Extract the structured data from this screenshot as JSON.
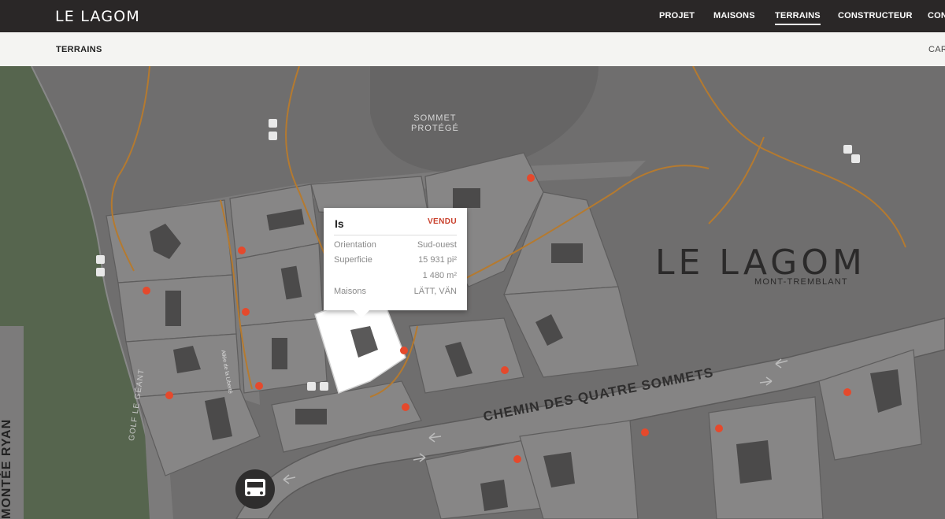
{
  "header": {
    "logo": "LE LAGOM",
    "nav": [
      {
        "label": "PROJET"
      },
      {
        "label": "MAISONS"
      },
      {
        "label": "TERRAINS",
        "active": true
      },
      {
        "label": "CONSTRUCTEUR"
      },
      {
        "label": "CON"
      }
    ]
  },
  "subheader": {
    "breadcrumb": "TERRAINS",
    "right_label": "CAR"
  },
  "map": {
    "labels": {
      "summit_line1": "SOMMET",
      "summit_line2": "PROTÉGÉ",
      "brand": "LE LAGOM",
      "brand_sub": "MONT-TREMBLANT",
      "road_main": "CHEMIN DES QUATRE SOMMETS",
      "road_left": "MONTÉE RYAN",
      "golf": "GOLF LE GÉANT",
      "allee": "Allée de la Liberté"
    },
    "colors": {
      "background": "#6f6e6e",
      "lot": "#8a8989",
      "lot_selected": "#ffffff",
      "road": "#9b9a9a",
      "golf": "#56654e",
      "marker": "#e5492c",
      "trail": "#b57a2f"
    },
    "icons": [
      "bus-icon",
      "hiker-icon",
      "cyclist-icon"
    ]
  },
  "popup": {
    "title": "Is",
    "status": "VENDU",
    "rows": [
      {
        "label": "Orientation",
        "value": "Sud-ouest"
      },
      {
        "label": "Superficie",
        "value": "15 931 pi²"
      },
      {
        "label": "",
        "value": "1 480 m²"
      },
      {
        "label": "Maisons",
        "value": "LÄTT, VÄN"
      }
    ]
  }
}
